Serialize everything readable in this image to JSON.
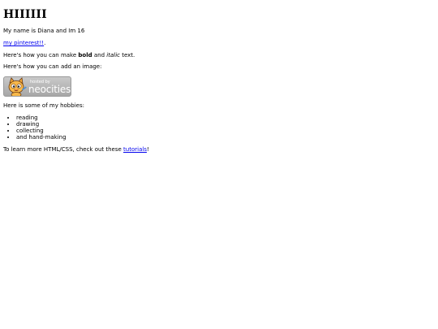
{
  "heading": "HIIIIII",
  "intro": "My name is Diana and Im 16",
  "pinterest": {
    "link_text": "my pinterest!!",
    "suffix": "."
  },
  "formatting": {
    "prefix": "Here's how you can make ",
    "bold": "bold",
    "middle": " and ",
    "italic": "italic",
    "suffix": " text."
  },
  "image_intro": "Here's how you can add an image:",
  "logo": {
    "small_text": "hosted by",
    "brand": "neocities",
    "icon": "neocities-cat-logo"
  },
  "hobbies": {
    "intro": "Here is some of my hobbies:",
    "items": [
      "reading",
      "drawing",
      "collecting",
      "and hand-making"
    ]
  },
  "learn_more": {
    "prefix": "To learn more HTML/CSS, check out these ",
    "link_text": "tutorials",
    "suffix": "!"
  },
  "colors": {
    "link": "#0000ee",
    "text": "#000000",
    "background": "#ffffff",
    "logo_bg": "#b8b8b8",
    "cat_orange": "#f2a93b"
  }
}
